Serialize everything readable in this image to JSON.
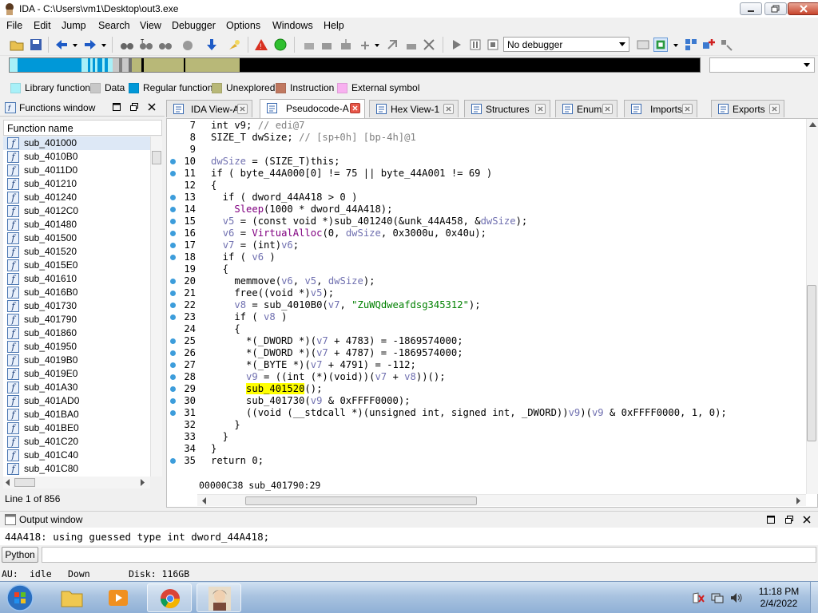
{
  "window": {
    "title": "IDA - C:\\Users\\vm1\\Desktop\\out3.exe"
  },
  "menu": [
    "File",
    "Edit",
    "Jump",
    "Search",
    "View",
    "Debugger",
    "Options",
    "Windows",
    "Help"
  ],
  "toolbar": {
    "debugger_select": "No debugger"
  },
  "legend": [
    {
      "label": "Library function",
      "color": "#a8f0f8"
    },
    {
      "label": "Data",
      "color": "#c8c8c8"
    },
    {
      "label": "Regular function",
      "color": "#0098d8"
    },
    {
      "label": "Unexplored",
      "color": "#b8b878"
    },
    {
      "label": "Instruction",
      "color": "#c07860"
    },
    {
      "label": "External symbol",
      "color": "#f8b0f0"
    }
  ],
  "functions_window": {
    "title": "Functions window",
    "column_header": "Function name",
    "items": [
      "sub_401000",
      "sub_4010B0",
      "sub_4011D0",
      "sub_401210",
      "sub_401240",
      "sub_4012C0",
      "sub_401480",
      "sub_401500",
      "sub_401520",
      "sub_4015E0",
      "sub_401610",
      "sub_4016B0",
      "sub_401730",
      "sub_401790",
      "sub_401860",
      "sub_401950",
      "sub_4019B0",
      "sub_4019E0",
      "sub_401A30",
      "sub_401AD0",
      "sub_401BA0",
      "sub_401BE0",
      "sub_401C20",
      "sub_401C40",
      "sub_401C80"
    ],
    "status": "Line 1 of 856"
  },
  "tabs": [
    {
      "label": "IDA View-A",
      "active": false
    },
    {
      "label": "Pseudocode-A",
      "active": true
    },
    {
      "label": "Hex View-1",
      "active": false
    },
    {
      "label": "Structures",
      "active": false
    },
    {
      "label": "Enums",
      "active": false
    },
    {
      "label": "Imports",
      "active": false
    },
    {
      "label": "Exports",
      "active": false
    }
  ],
  "code": [
    {
      "n": "7",
      "dot": false,
      "t": "int v9; // edi@7"
    },
    {
      "n": "8",
      "dot": false,
      "t": "SIZE_T dwSize; // [sp+0h] [bp-4h]@1"
    },
    {
      "n": "9",
      "dot": false,
      "t": ""
    },
    {
      "n": "10",
      "dot": true,
      "t": "dwSize = (SIZE_T)this;"
    },
    {
      "n": "11",
      "dot": true,
      "t": "if ( byte_44A000[0] != 75 || byte_44A001 != 69 )"
    },
    {
      "n": "12",
      "dot": false,
      "t": "{"
    },
    {
      "n": "13",
      "dot": true,
      "t": "  if ( dword_44A418 > 0 )"
    },
    {
      "n": "14",
      "dot": true,
      "t": "    Sleep(1000 * dword_44A418);"
    },
    {
      "n": "15",
      "dot": true,
      "t": "  v5 = (const void *)sub_401240(&unk_44A458, &dwSize);"
    },
    {
      "n": "16",
      "dot": true,
      "t": "  v6 = VirtualAlloc(0, dwSize, 0x3000u, 0x40u);"
    },
    {
      "n": "17",
      "dot": true,
      "t": "  v7 = (int)v6;"
    },
    {
      "n": "18",
      "dot": true,
      "t": "  if ( v6 )"
    },
    {
      "n": "19",
      "dot": false,
      "t": "  {"
    },
    {
      "n": "20",
      "dot": true,
      "t": "    memmove(v6, v5, dwSize);"
    },
    {
      "n": "21",
      "dot": true,
      "t": "    free((void *)v5);"
    },
    {
      "n": "22",
      "dot": true,
      "t": "    v8 = sub_4010B0(v7, \"ZuWQdweafdsg345312\");"
    },
    {
      "n": "23",
      "dot": true,
      "t": "    if ( v8 )"
    },
    {
      "n": "24",
      "dot": false,
      "t": "    {"
    },
    {
      "n": "25",
      "dot": true,
      "t": "      *(_DWORD *)(v7 + 4783) = -1869574000;"
    },
    {
      "n": "26",
      "dot": true,
      "t": "      *(_DWORD *)(v7 + 4787) = -1869574000;"
    },
    {
      "n": "27",
      "dot": true,
      "t": "      *(_BYTE *)(v7 + 4791) = -112;"
    },
    {
      "n": "28",
      "dot": true,
      "t": "      v9 = ((int (*)(void))(v7 + v8))();"
    },
    {
      "n": "29",
      "dot": true,
      "t": "      sub_401520();"
    },
    {
      "n": "30",
      "dot": true,
      "t": "      sub_401730(v9 & 0xFFFF0000);"
    },
    {
      "n": "31",
      "dot": true,
      "t": "      ((void (__stdcall *)(unsigned int, signed int, _DWORD))v9)(v9 & 0xFFFF0000, 1, 0);"
    },
    {
      "n": "32",
      "dot": false,
      "t": "    }"
    },
    {
      "n": "33",
      "dot": false,
      "t": "  }"
    },
    {
      "n": "34",
      "dot": false,
      "t": "}"
    },
    {
      "n": "35",
      "dot": true,
      "t": "return 0;"
    }
  ],
  "code_status": "00000C38 sub_401790:29",
  "output_window": {
    "title": "Output window",
    "text": "44A418: using guessed type int dword_44A418;",
    "python_button": "Python"
  },
  "status_bar": {
    "au": "AU:",
    "state": "idle",
    "direction": "Down",
    "disk": "Disk: 116GB"
  },
  "clock": {
    "time": "11:18 PM",
    "date": "2/4/2022"
  }
}
